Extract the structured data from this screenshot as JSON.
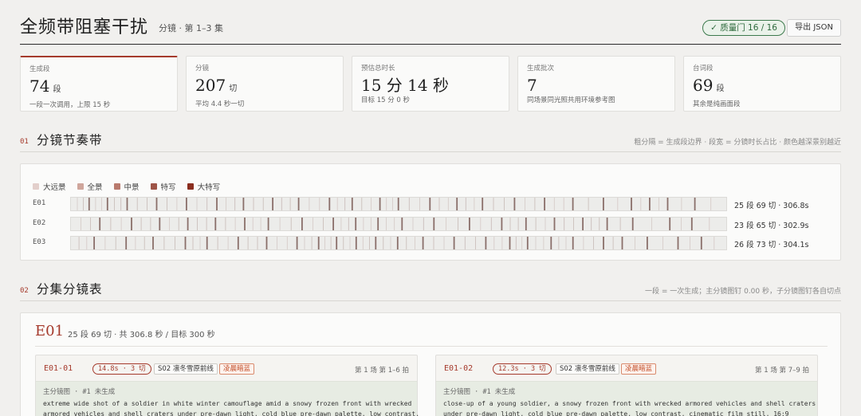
{
  "header": {
    "title": "全频带阻塞干扰",
    "subtitle": "分镜 · 第 1–3 集",
    "gate_badge": "✓ 质量门 16 / 16",
    "export_label": "导出 JSON"
  },
  "stats": [
    {
      "label": "生成段",
      "value": "74",
      "unit": "段",
      "note": "一段一次调用，上限 15 秒"
    },
    {
      "label": "分镜",
      "value": "207",
      "unit": "切",
      "note": "平均 4.4 秒一切"
    },
    {
      "label": "预估总时长",
      "value": "15 分 14 秒",
      "unit": "",
      "note": "目标 15 分 0 秒"
    },
    {
      "label": "生成批次",
      "value": "7",
      "unit": "",
      "note": "同场景同光照共用环境参考图"
    },
    {
      "label": "台词段",
      "value": "69",
      "unit": "段",
      "note": "其余是纯画面段"
    }
  ],
  "section1": {
    "num": "01",
    "title": "分镜节奏带",
    "note": "粗分隔 = 生成段边界 · 段宽 = 分镜时长占比 · 颜色越深景别越近"
  },
  "legend": [
    {
      "label": "大远景",
      "color": "#e3cfcb"
    },
    {
      "label": "全景",
      "color": "#cfa69c"
    },
    {
      "label": "中景",
      "color": "#b97a6d"
    },
    {
      "label": "特写",
      "color": "#9e5447"
    },
    {
      "label": "大特写",
      "color": "#8a2d1e"
    }
  ],
  "bands": [
    {
      "ep": "E01",
      "summary": "25 段 69 切 · 306.8s",
      "segments": 25,
      "cuts": 69
    },
    {
      "ep": "E02",
      "summary": "23 段 65 切 · 302.9s",
      "segments": 23,
      "cuts": 65
    },
    {
      "ep": "E03",
      "summary": "26 段 73 切 · 304.1s",
      "segments": 26,
      "cuts": 73
    }
  ],
  "section2": {
    "num": "02",
    "title": "分集分镜表",
    "note": "一段 = 一次生成；主分镜图钉 0.00 秒，子分镜图钉各自切点"
  },
  "episode": {
    "id": "E01",
    "meta": "25 段 69 切 · 共 306.8 秒 / 目标 300 秒"
  },
  "shots": [
    {
      "id": "E01-01",
      "duration": "14.8s · 3 切",
      "location": "S02 凛冬雪原前线",
      "light": "凌晨暗蓝",
      "range": "第 1 场 第 1–6 拍",
      "prompt_label": "主分镜图 · #1 未生成",
      "prompt_lines": [
        "extreme wide shot of a soldier in white winter camouflage amid a snowy frozen front with wrecked",
        "armored vehicles and shell craters under pre-dawn light, cold blue pre-dawn palette, low contrast,"
      ]
    },
    {
      "id": "E01-02",
      "duration": "12.3s · 3 切",
      "location": "S02 凛冬雪原前线",
      "light": "凌晨暗蓝",
      "range": "第 1 场 第 7–9 拍",
      "prompt_label": "主分镜图 · #1 未生成",
      "prompt_lines": [
        "close-up of a young soldier, a snowy frozen front with wrecked armored vehicles and shell craters",
        "under pre-dawn light, cold blue pre-dawn palette, low contrast, cinematic film still, 16:9"
      ]
    }
  ]
}
